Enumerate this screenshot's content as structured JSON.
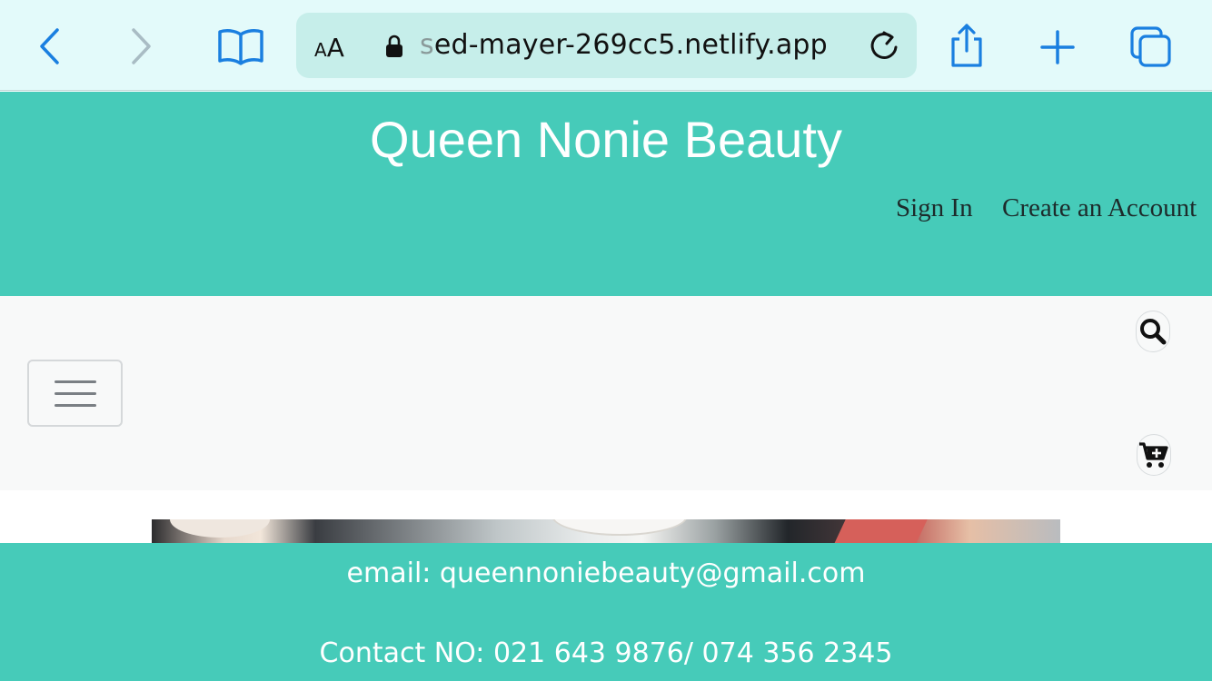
{
  "browser": {
    "text_size_small": "A",
    "text_size_large": "A",
    "url_faded_prefix": "s",
    "url_rest": "ed-mayer-269cc5.netlify.app",
    "accent_color": "#1a7fe0",
    "icons": [
      "back-icon",
      "forward-icon",
      "bookmarks-icon",
      "lock-icon",
      "reload-icon",
      "share-icon",
      "new-tab-icon",
      "tabs-icon"
    ]
  },
  "header": {
    "title": "Queen Nonie Beauty",
    "sign_in": "Sign In",
    "create_account": "Create an Account",
    "background_color": "#46cbb9"
  },
  "nav": {
    "icons": [
      "menu-icon",
      "search-icon",
      "cart-plus-icon"
    ]
  },
  "footer": {
    "email": "email: queennoniebeauty@gmail.com",
    "contact": "Contact NO: 021 643 9876/ 074 356 2345",
    "background_color": "#46cbb9"
  }
}
